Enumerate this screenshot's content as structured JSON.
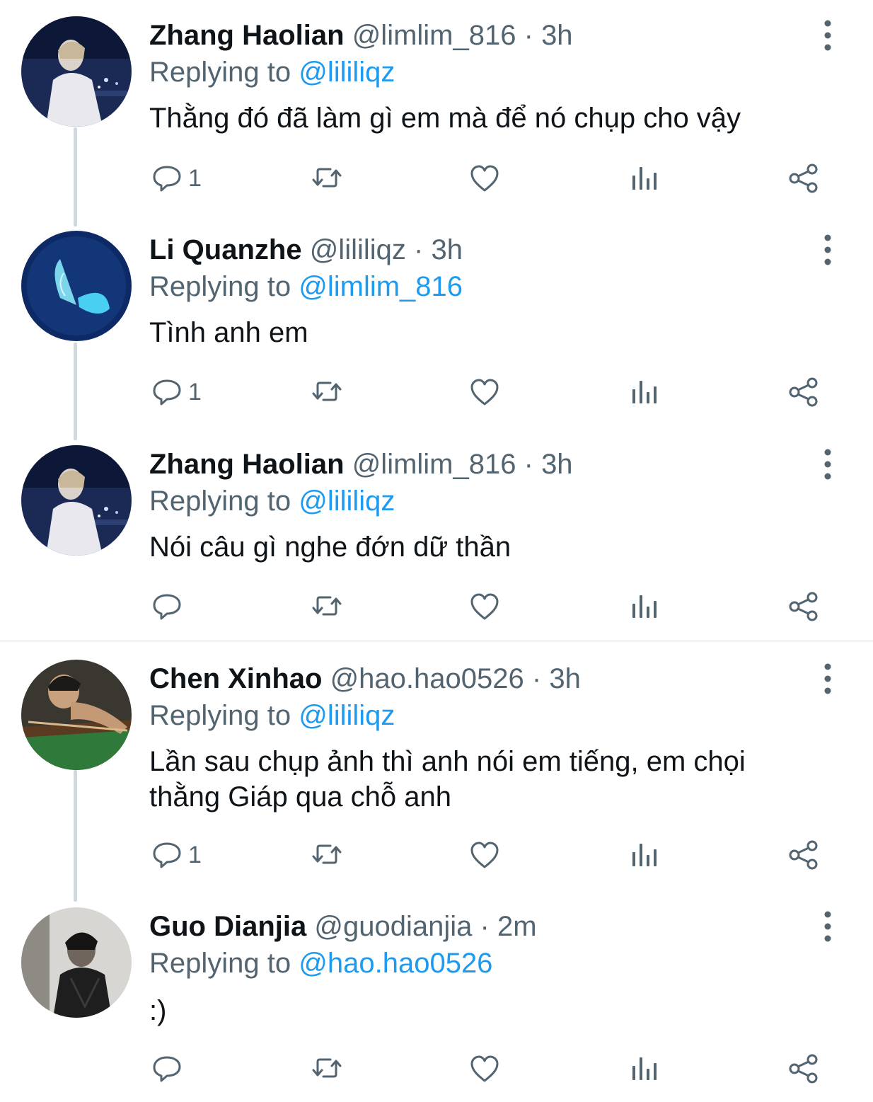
{
  "tweets": [
    {
      "name": "Zhang Haolian",
      "handle": "@limlim_816",
      "separator": "·",
      "time": "3h",
      "replying_prefix": "Replying to",
      "replying_to": "@lililiqz",
      "text": "Thằng đó đã làm gì em mà để nó chụp cho vậy",
      "reply_count": "1",
      "avatar": "night-portrait"
    },
    {
      "name": "Li Quanzhe",
      "handle": "@lililiqz",
      "separator": "·",
      "time": "3h",
      "replying_prefix": "Replying to",
      "replying_to": "@limlim_816",
      "text": "Tình anh em",
      "reply_count": "1",
      "avatar": "glowing-butterfly"
    },
    {
      "name": "Zhang Haolian",
      "handle": "@limlim_816",
      "separator": "·",
      "time": "3h",
      "replying_prefix": "Replying to",
      "replying_to": "@lililiqz",
      "text": "Nói câu gì nghe đớn dữ thần",
      "reply_count": "",
      "avatar": "night-portrait"
    },
    {
      "name": "Chen Xinhao",
      "handle": "@hao.hao0526",
      "separator": "·",
      "time": "3h",
      "replying_prefix": "Replying to",
      "replying_to": "@lililiqz",
      "text_line1": "Lần sau chụp ảnh thì anh nói em tiếng, em chọi",
      "text_line2": "thằng Giáp qua chỗ anh",
      "reply_count": "1",
      "avatar": "billiards-player"
    },
    {
      "name": "Guo Dianjia",
      "handle": "@guodianjia",
      "separator": "·",
      "time": "2m",
      "replying_prefix": "Replying to",
      "replying_to": "@hao.hao0526",
      "text": ":)",
      "reply_count": "",
      "avatar": "dark-portrait"
    }
  ],
  "icons": {
    "reply": "reply-icon",
    "retweet": "retweet-icon",
    "like": "heart-icon",
    "analytics": "analytics-icon",
    "share": "share-icon",
    "more": "more-vertical-icon"
  },
  "colors": {
    "link": "#1d9bf0",
    "secondary_text": "#536471",
    "primary_text": "#0f1419",
    "thread_line": "#cfd9de"
  }
}
